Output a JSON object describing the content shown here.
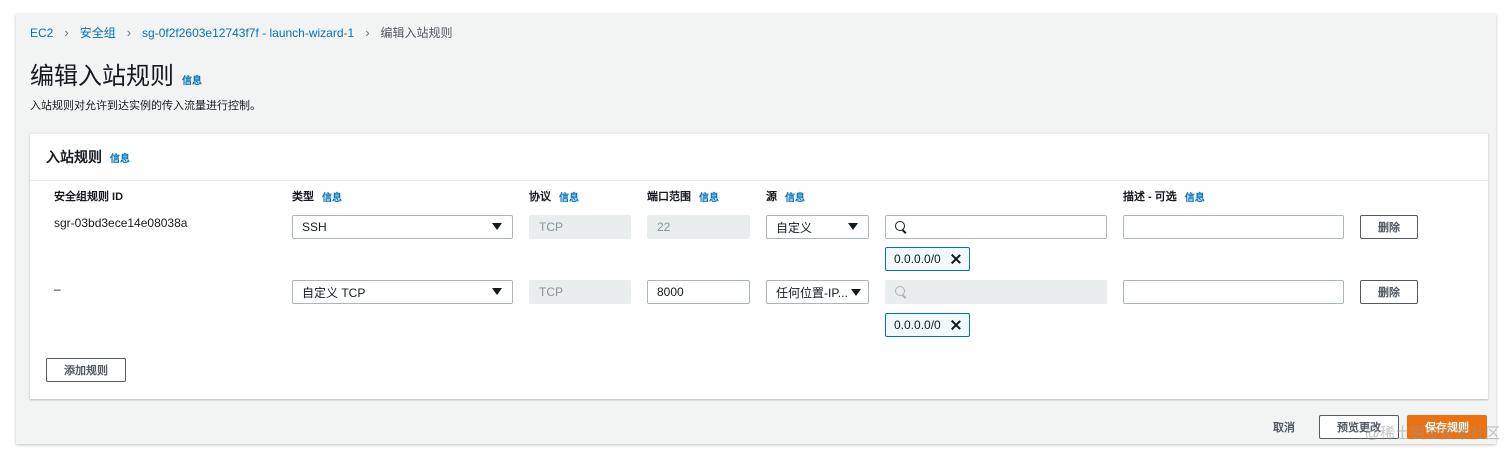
{
  "breadcrumb": {
    "items": [
      "EC2",
      "安全组",
      "sg-0f2f2603e12743f7f - launch-wizard-1"
    ],
    "current": "编辑入站规则"
  },
  "header": {
    "title": "编辑入站规则",
    "info": "信息",
    "description": "入站规则对允许到达实例的传入流量进行控制。"
  },
  "panel": {
    "title": "入站规则",
    "info": "信息",
    "columns": {
      "rule_id": "安全组规则 ID",
      "type": "类型",
      "protocol": "协议",
      "port_range": "端口范围",
      "source": "源",
      "description": "描述 - 可选",
      "info": "信息"
    },
    "rules": [
      {
        "id": "sgr-03bd3ece14e08038a",
        "type": "SSH",
        "protocol": "TCP",
        "port": "22",
        "source_type": "自定义",
        "search_value": "",
        "token": "0.0.0.0/0",
        "description": "",
        "delete": "删除"
      },
      {
        "id": "–",
        "type": "自定义 TCP",
        "protocol": "TCP",
        "port": "8000",
        "source_type": "任何位置-IP...",
        "search_value": "",
        "token": "0.0.0.0/0",
        "description": "",
        "delete": "删除"
      }
    ],
    "add_rule": "添加规则"
  },
  "footer": {
    "cancel": "取消",
    "preview": "预览更改",
    "save": "保存规则"
  },
  "watermark": "@稀土掘金技术社区",
  "colors": {
    "link": "#0073bb",
    "primary": "#ec7211",
    "background": "#f2f3f3"
  }
}
